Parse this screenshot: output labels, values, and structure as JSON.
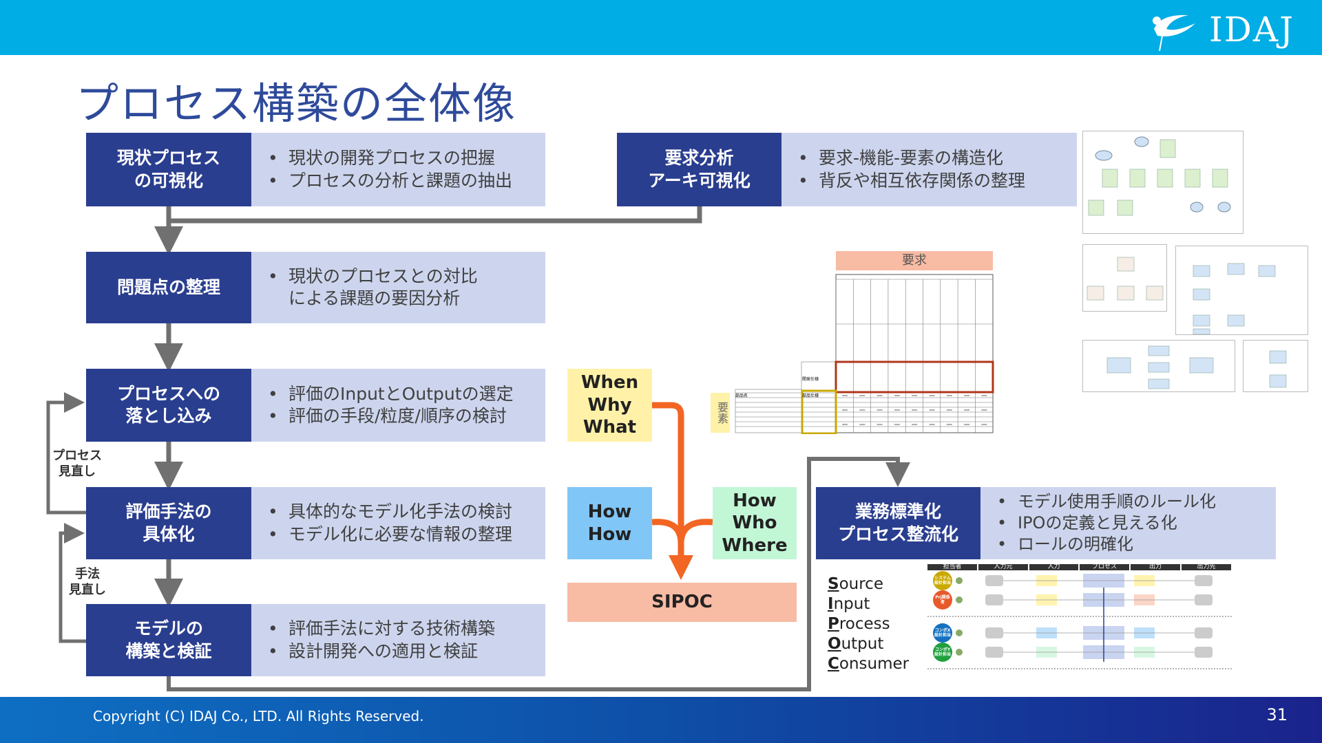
{
  "header": {
    "logo_text": "IDAJ"
  },
  "title": "プロセス構築の全体像",
  "steps": [
    {
      "label": "現状プロセス\nの可視化",
      "bullets": [
        "現状の開発プロセスの把握",
        "プロセスの分析と課題の抽出"
      ]
    },
    {
      "label": "問題点の整理",
      "bullets": [
        "現状のプロセスとの対比\nによる課題の要因分析"
      ]
    },
    {
      "label": "プロセスへの\n落とし込み",
      "bullets": [
        "評価のInputとOutputの選定",
        "評価の手段/粒度/順序の検討"
      ]
    },
    {
      "label": "評価手法の\n具体化",
      "bullets": [
        "具体的なモデル化手法の検討",
        "モデル化に必要な情報の整理"
      ]
    },
    {
      "label": "モデルの\n構築と検証",
      "bullets": [
        "評価手法に対する技術構築",
        "設計開発への適用と検証"
      ]
    }
  ],
  "requirements_step": {
    "label": "要求分析\nアーキ可視化",
    "bullets": [
      "要求-機能-要素の構造化",
      "背反や相互依存関係の整理"
    ]
  },
  "standardization_step": {
    "label": "業務標準化\nプロセス整流化",
    "bullets": [
      "モデル使用手順のルール化",
      "IPOの定義と見える化",
      "ロールの明確化"
    ]
  },
  "loop_labels": {
    "process_review": "プロセス\n見直し",
    "method_review": "手法\n見直し"
  },
  "w_boxes": {
    "when_why_what": "When\nWhy\nWhat",
    "how_how": "How\nHow",
    "how_who_where": "How\nWho\nWhere",
    "sipoc": "SIPOC"
  },
  "sipoc_letters": [
    {
      "initial": "S",
      "rest": "ource"
    },
    {
      "initial": "I",
      "rest": "nput"
    },
    {
      "initial": "P",
      "rest": "rocess"
    },
    {
      "initial": "O",
      "rest": "utput"
    },
    {
      "initial": "C",
      "rest": "onsumer"
    }
  ],
  "matrix": {
    "requirement_label": "要求",
    "element_label": "要素",
    "spec_label": "開発仕様",
    "part_label": "部品名",
    "part_spec_label": "部品仕様"
  },
  "sipoc_diagram": {
    "headers": [
      "担当者",
      "入力元",
      "入力",
      "プロセス",
      "出力",
      "出力先"
    ],
    "roles": [
      {
        "label": "システム設計担当",
        "color": "#C9A800"
      },
      {
        "label": "Prj関係者",
        "color": "#E8582A"
      },
      {
        "label": "コンポX設計担当",
        "color": "#1570C0"
      },
      {
        "label": "コンポY設計担当",
        "color": "#1FA03C"
      }
    ]
  },
  "colors": {
    "dark": "#2A3E8F",
    "light": "#CDD5EE",
    "topbar": "#00ADE5",
    "arrow": "#707070",
    "flow_arrow": "#F26522",
    "when": "#FFF2A8",
    "how": "#80C6F7",
    "who": "#C2F7D6",
    "sipoc": "#F8BBA4"
  },
  "footer": {
    "copyright": "Copyright (C) IDAJ Co., LTD. All Rights Reserved.",
    "page": "31"
  }
}
